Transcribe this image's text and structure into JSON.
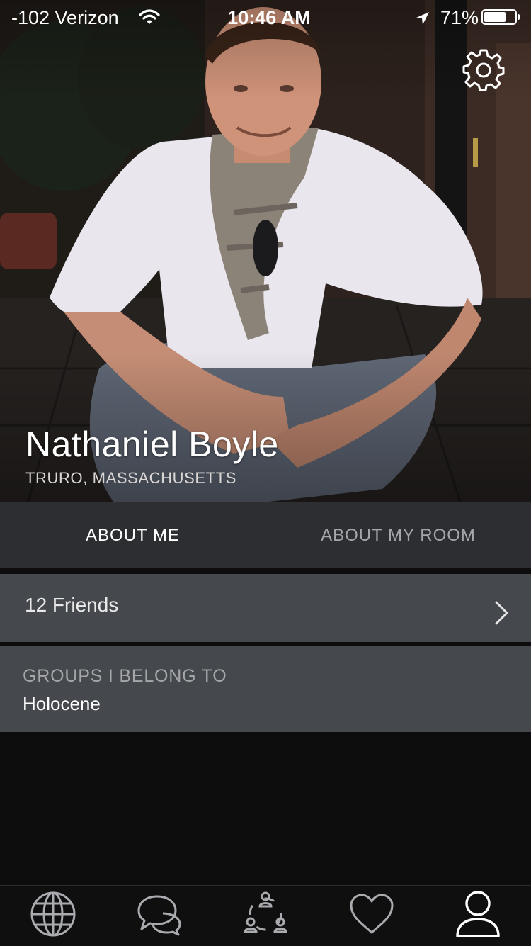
{
  "status_bar": {
    "carrier": "-102 Verizon",
    "time": "10:46 AM",
    "battery_percent": "71%",
    "battery_level": 0.71,
    "icons": [
      "wifi-icon",
      "location-arrow-icon",
      "battery-icon"
    ]
  },
  "profile": {
    "name": "Nathaniel Boyle",
    "location": "TRURO, MASSACHUSETTS",
    "settings_icon": "gear-icon"
  },
  "tabs": [
    {
      "label": "ABOUT ME",
      "active": true
    },
    {
      "label": "ABOUT MY ROOM",
      "active": false
    }
  ],
  "friends": {
    "label": "12 Friends",
    "icon": "chevron-right-icon"
  },
  "groups": {
    "heading": "GROUPS I BELONG TO",
    "items": [
      "Holocene"
    ]
  },
  "tab_bar": {
    "items": [
      {
        "icon": "globe-icon",
        "active": false
      },
      {
        "icon": "chat-bubbles-icon",
        "active": false
      },
      {
        "icon": "group-icon",
        "active": false
      },
      {
        "icon": "heart-icon",
        "active": false
      },
      {
        "icon": "user-icon",
        "active": true
      }
    ]
  },
  "colors": {
    "tab_bg": "#2c2e32",
    "row_bg": "#45484c",
    "page_bg": "#0d0d0e",
    "muted_text": "#a4a6aa"
  }
}
